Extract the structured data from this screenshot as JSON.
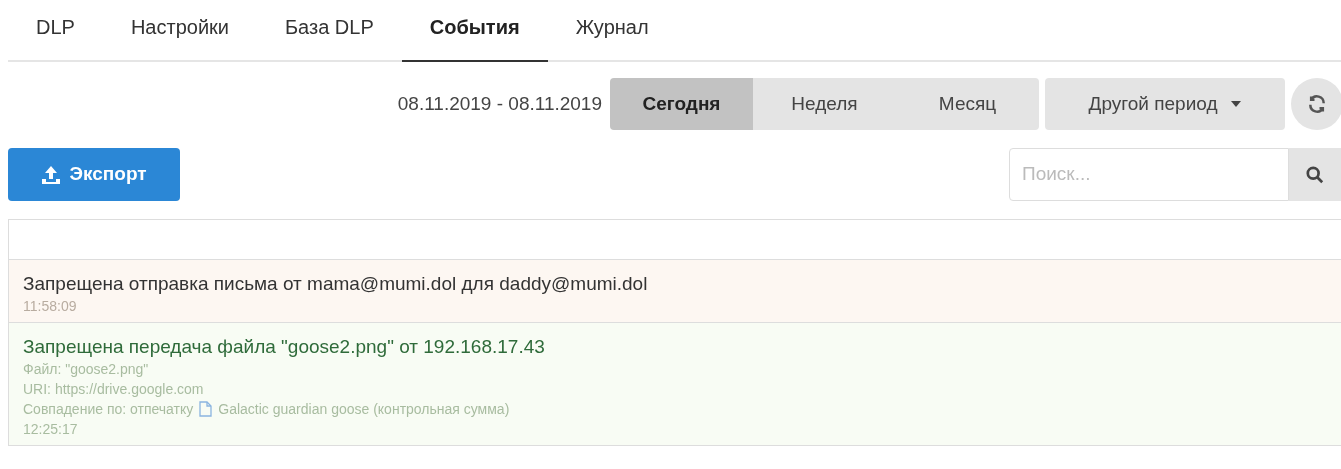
{
  "tabs": [
    {
      "label": "DLP",
      "selected": false
    },
    {
      "label": "Настройки",
      "selected": false
    },
    {
      "label": "База DLP",
      "selected": false
    },
    {
      "label": "События",
      "selected": true
    },
    {
      "label": "Журнал",
      "selected": false
    }
  ],
  "period": {
    "range": "08.11.2019 - 08.11.2019",
    "options": [
      {
        "label": "Сегодня",
        "selected": true
      },
      {
        "label": "Неделя",
        "selected": false
      },
      {
        "label": "Месяц",
        "selected": false
      }
    ],
    "other": "Другой период"
  },
  "export_button": "Экспорт",
  "search": {
    "placeholder": "Поиск..."
  },
  "events": [
    {
      "kind": "mail",
      "title": "Запрещена отправка письма от mama@mumi.dol для daddy@mumi.dol",
      "time": "11:58:09"
    },
    {
      "kind": "file",
      "title": "Запрещена передача файла \"goose2.png\" от 192.168.17.43",
      "details": [
        {
          "text": "Файл: \"goose2.png\""
        },
        {
          "text": "URI: https://drive.google.com"
        },
        {
          "text": "Совпадение по: отпечатку",
          "doc": "Galactic guardian goose (контрольная сумма)"
        }
      ],
      "time": "12:25:17"
    }
  ]
}
